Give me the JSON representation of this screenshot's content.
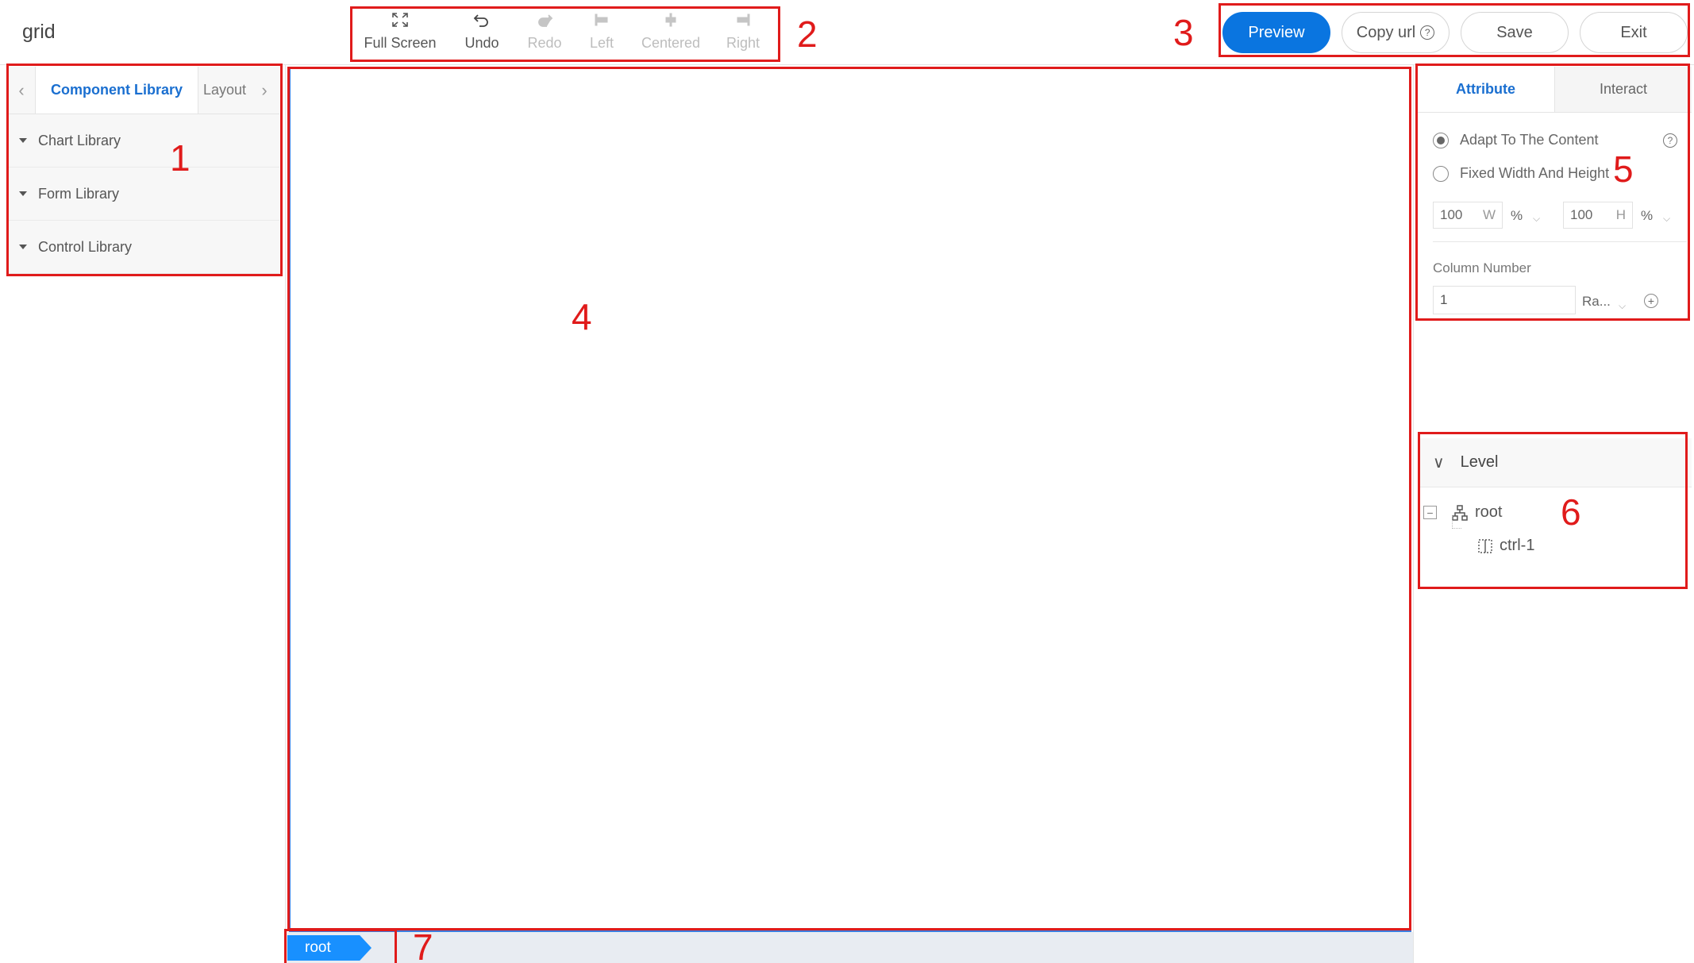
{
  "app": {
    "title": "grid"
  },
  "toolbar": {
    "items": [
      {
        "label": "Full Screen",
        "icon": "fullscreen-icon",
        "enabled": true
      },
      {
        "label": "Undo",
        "icon": "undo-icon",
        "enabled": true
      },
      {
        "label": "Redo",
        "icon": "redo-icon",
        "enabled": false
      },
      {
        "label": "Left",
        "icon": "align-left-icon",
        "enabled": false
      },
      {
        "label": "Centered",
        "icon": "align-center-icon",
        "enabled": false
      },
      {
        "label": "Right",
        "icon": "align-right-icon",
        "enabled": false
      }
    ]
  },
  "actions": {
    "preview": "Preview",
    "copy_url": "Copy url",
    "help_glyph": "?",
    "save": "Save",
    "exit": "Exit"
  },
  "left_panel": {
    "tabs": [
      {
        "label": "Component Library",
        "active": true
      },
      {
        "label": "Layout",
        "active": false
      }
    ],
    "nav_prev": "‹",
    "nav_next": "›",
    "libraries": [
      "Chart Library",
      "Form Library",
      "Control Library"
    ]
  },
  "canvas": {
    "breadcrumb": "root"
  },
  "right_panel": {
    "tabs": [
      {
        "label": "Attribute",
        "active": true
      },
      {
        "label": "Interact",
        "active": false
      }
    ],
    "size_mode": {
      "options": [
        "Adapt To The Content",
        "Fixed Width And Height"
      ],
      "selected": "Adapt To The Content"
    },
    "width": {
      "value": "100",
      "suffix": "W",
      "unit": "%"
    },
    "height": {
      "value": "100",
      "suffix": "H",
      "unit": "%"
    },
    "column_number": {
      "label": "Column Number",
      "value": "1",
      "mode": "Ra...",
      "add_glyph": "+"
    },
    "level": {
      "title": "Level",
      "tree": [
        {
          "label": "root",
          "icon": "hierarchy-icon",
          "depth": 0
        },
        {
          "label": "ctrl-1",
          "icon": "grid-cell-icon",
          "depth": 1
        }
      ]
    }
  },
  "annotations": [
    "1",
    "2",
    "3",
    "4",
    "5",
    "6",
    "7"
  ],
  "colors": {
    "primary": "#0a75e0",
    "annotation": "#e01b1b",
    "canvas_border": "#3b7de0",
    "breadcrumb": "#1890ff"
  }
}
